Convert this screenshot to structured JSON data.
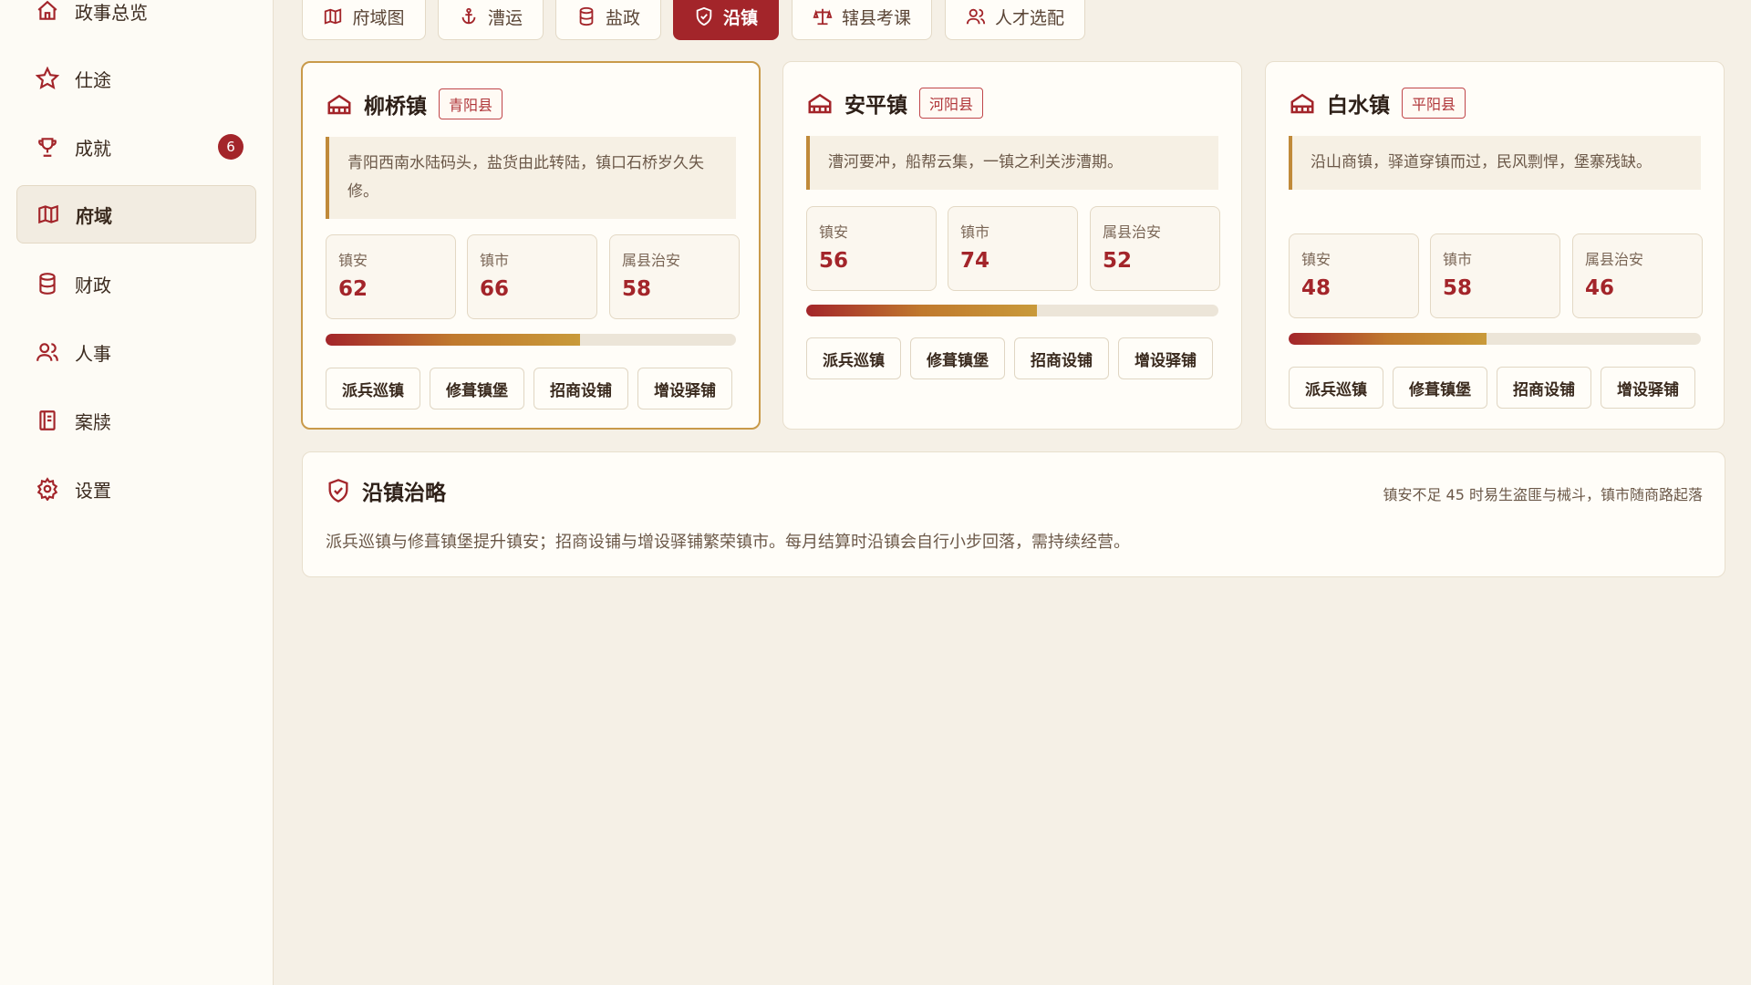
{
  "sidebar": {
    "items": [
      {
        "label": "政事总览",
        "icon": "home-icon"
      },
      {
        "label": "仕途",
        "icon": "star-icon"
      },
      {
        "label": "成就",
        "icon": "trophy-icon",
        "badge": "6"
      },
      {
        "label": "府域",
        "icon": "map-icon",
        "active": true
      },
      {
        "label": "财政",
        "icon": "database-icon"
      },
      {
        "label": "人事",
        "icon": "users-icon"
      },
      {
        "label": "案牍",
        "icon": "ledger-icon"
      },
      {
        "label": "设置",
        "icon": "gear-icon"
      }
    ]
  },
  "tabs": [
    {
      "label": "府域图",
      "icon": "map-icon"
    },
    {
      "label": "漕运",
      "icon": "anchor-icon"
    },
    {
      "label": "盐政",
      "icon": "database-icon"
    },
    {
      "label": "沿镇",
      "icon": "shield-icon",
      "active": true
    },
    {
      "label": "辖县考课",
      "icon": "scale-icon"
    },
    {
      "label": "人才选配",
      "icon": "users-icon"
    }
  ],
  "stat_labels": {
    "security": "镇安",
    "market": "镇市",
    "county_order": "属县治安"
  },
  "actions": [
    "派兵巡镇",
    "修葺镇堡",
    "招商设铺",
    "增设驿铺"
  ],
  "towns": [
    {
      "name": "柳桥镇",
      "county": "青阳县",
      "desc": "青阳西南水陆码头，盐货由此转陆，镇口石桥岁久失修。",
      "security": "62",
      "market": "66",
      "county_order": "58",
      "progress": 0.62,
      "selected": true
    },
    {
      "name": "安平镇",
      "county": "河阳县",
      "desc": "漕河要冲，船帮云集，一镇之利关涉漕期。",
      "security": "56",
      "market": "74",
      "county_order": "52",
      "progress": 0.56,
      "selected": false
    },
    {
      "name": "白水镇",
      "county": "平阳县",
      "desc": "沿山商镇，驿道穿镇而过，民风剽悍，堡寨残缺。",
      "security": "48",
      "market": "58",
      "county_order": "46",
      "progress": 0.48,
      "selected": false
    }
  ],
  "strategy": {
    "title": "沿镇治略",
    "note": "镇安不足 45 时易生盗匪与械斗，镇市随商路起落",
    "body": "派兵巡镇与修葺镇堡提升镇安；招商设铺与增设驿铺繁荣镇市。每月结算时沿镇会自行小步回落，需持续经营。"
  },
  "colors": {
    "accent": "#a3252a",
    "gold": "#c99a4a",
    "background": "#f5f0e6"
  }
}
